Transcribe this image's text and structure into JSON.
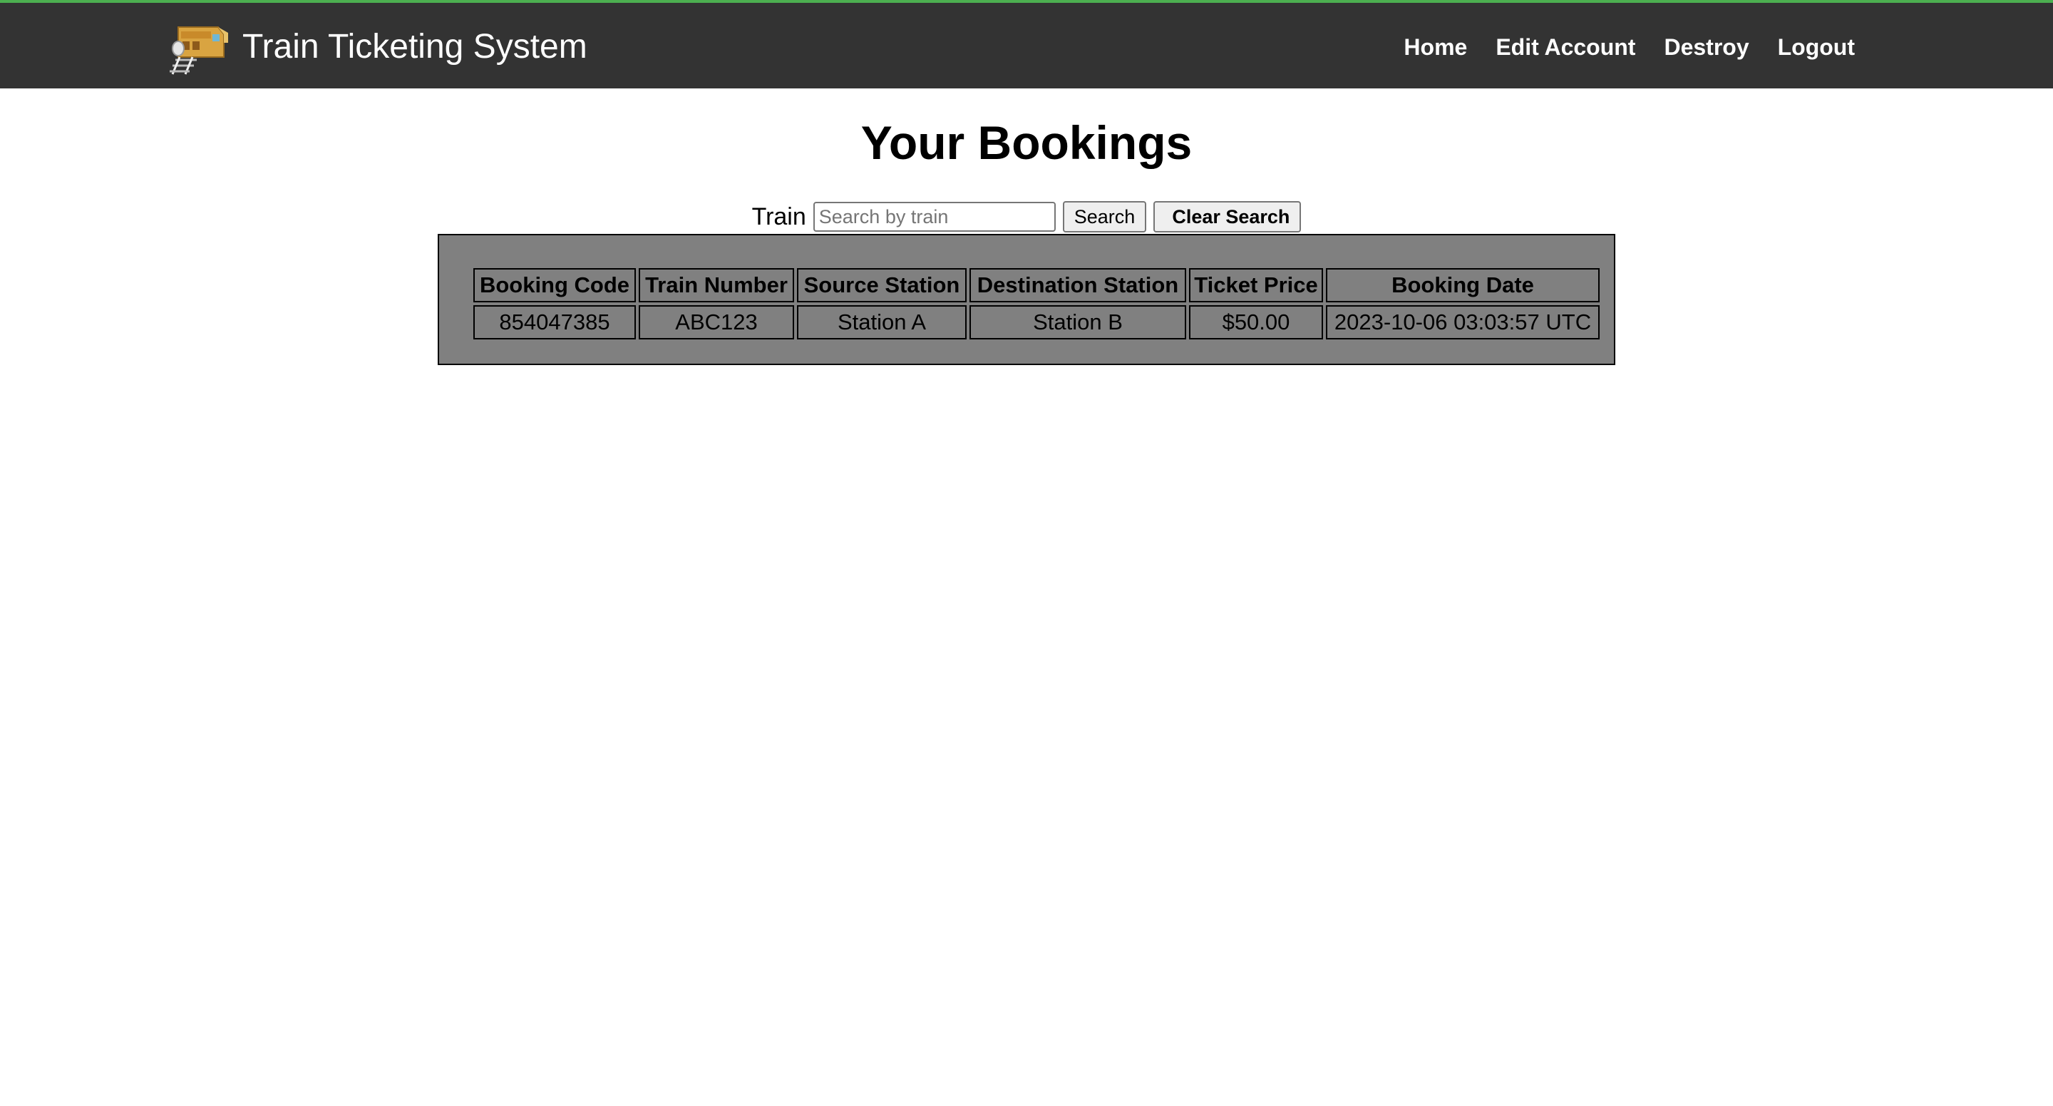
{
  "header": {
    "title": "Train Ticketing System",
    "logo_icon": "train-icon",
    "accent_color": "#4caf50",
    "background_color": "#333333",
    "nav": [
      {
        "label": "Home"
      },
      {
        "label": "Edit Account"
      },
      {
        "label": "Destroy"
      },
      {
        "label": "Logout"
      }
    ]
  },
  "main": {
    "title": "Your Bookings",
    "search": {
      "label": "Train",
      "value": "",
      "placeholder": "Search by train",
      "search_button": "Search",
      "clear_button": "Clear Search"
    },
    "table": {
      "background_color": "#808080",
      "columns": [
        "Booking Code",
        "Train Number",
        "Source Station",
        "Destination Station",
        "Ticket Price",
        "Booking Date"
      ],
      "rows": [
        [
          "854047385",
          "ABC123",
          "Station A",
          "Station B",
          "$50.00",
          "2023-10-06 03:03:57 UTC"
        ]
      ]
    }
  }
}
